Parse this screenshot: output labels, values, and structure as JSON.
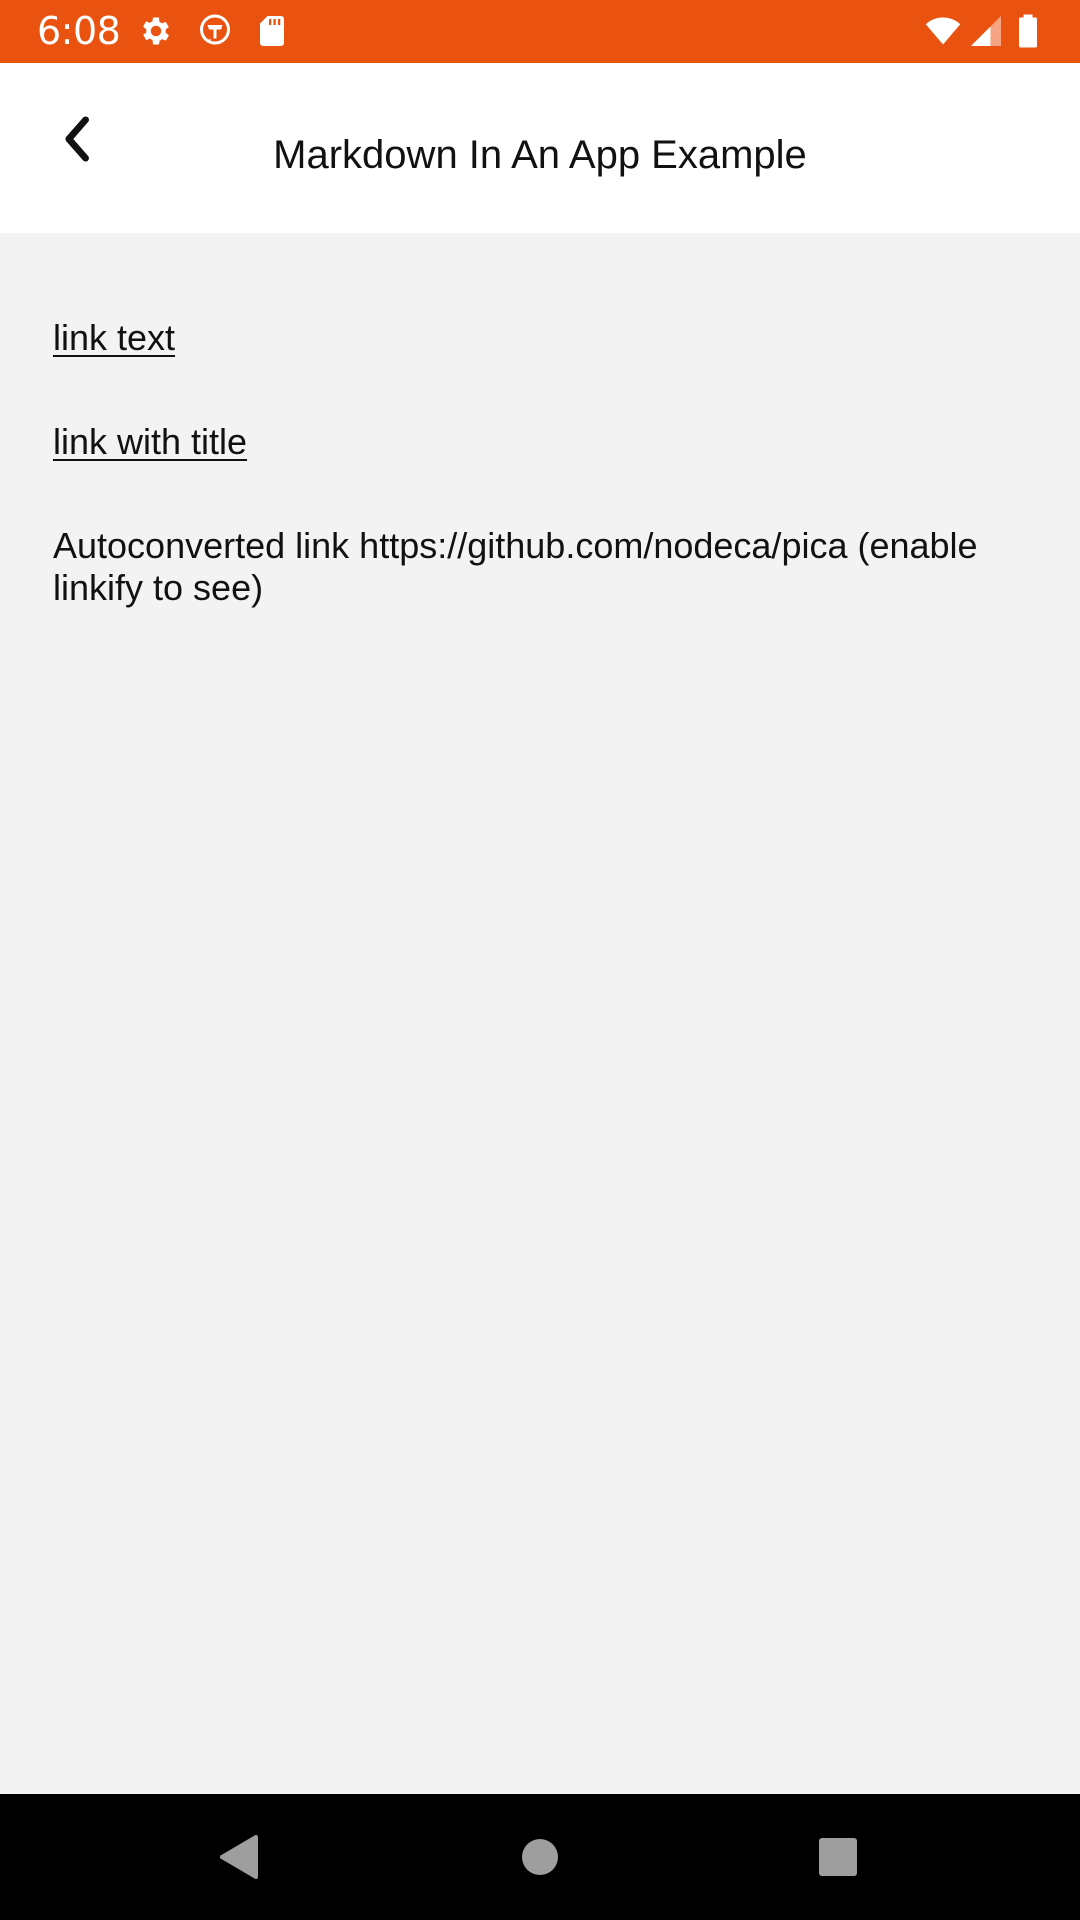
{
  "status_bar": {
    "time": "6:08",
    "background_color": "#e9520f",
    "left_icons": [
      "settings-gear-icon",
      "app-notification-icon",
      "sd-card-icon"
    ],
    "right_icons": [
      "wifi-icon",
      "cellular-signal-icon",
      "battery-icon"
    ]
  },
  "app_bar": {
    "title": "Markdown In An App Example",
    "back_icon": "chevron-left-icon"
  },
  "content": {
    "link_text": "link text",
    "link_with_title": "link with title",
    "autoconverted_text": "Autoconverted link https://github.com/nodeca/pica (enable linkify to see)"
  },
  "nav_bar": {
    "buttons": [
      "back-triangle-icon",
      "home-circle-icon",
      "recents-square-icon"
    ]
  }
}
